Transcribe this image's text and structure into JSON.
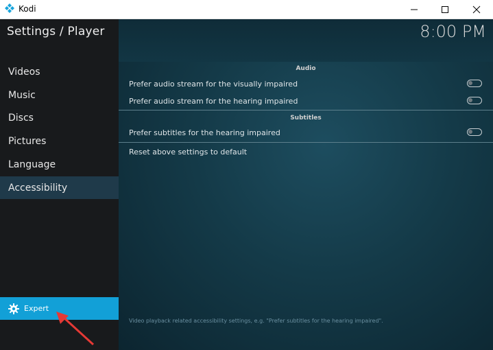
{
  "window": {
    "title": "Kodi",
    "logo_icon": "kodi-logo-icon",
    "controls": [
      "minimize-icon",
      "maximize-icon",
      "close-icon"
    ]
  },
  "header": {
    "page_title": "Settings / Player",
    "clock": "8:00 PM"
  },
  "sidebar": {
    "items": [
      {
        "label": "Videos",
        "active": false
      },
      {
        "label": "Music",
        "active": false
      },
      {
        "label": "Discs",
        "active": false
      },
      {
        "label": "Pictures",
        "active": false
      },
      {
        "label": "Language",
        "active": false
      },
      {
        "label": "Accessibility",
        "active": true
      }
    ],
    "expert": {
      "label": "Expert",
      "icon": "gear-icon"
    }
  },
  "main": {
    "sections": [
      {
        "header": "Audio",
        "settings": [
          {
            "label": "Prefer audio stream for the visually impaired",
            "toggle": false
          },
          {
            "label": "Prefer audio stream for the hearing impaired",
            "toggle": false
          }
        ]
      },
      {
        "header": "Subtitles",
        "settings": [
          {
            "label": "Prefer subtitles for the hearing impaired",
            "toggle": false
          }
        ]
      }
    ],
    "reset_label": "Reset above settings to default",
    "help_text": "Video playback related accessibility settings, e.g. \"Prefer subtitles for the hearing impaired\"."
  },
  "colors": {
    "accent": "#12a0d7",
    "sidebar_bg": "#181a1c",
    "active_item_bg": "#1f3a4a",
    "annotation_arrow": "#e53935"
  }
}
